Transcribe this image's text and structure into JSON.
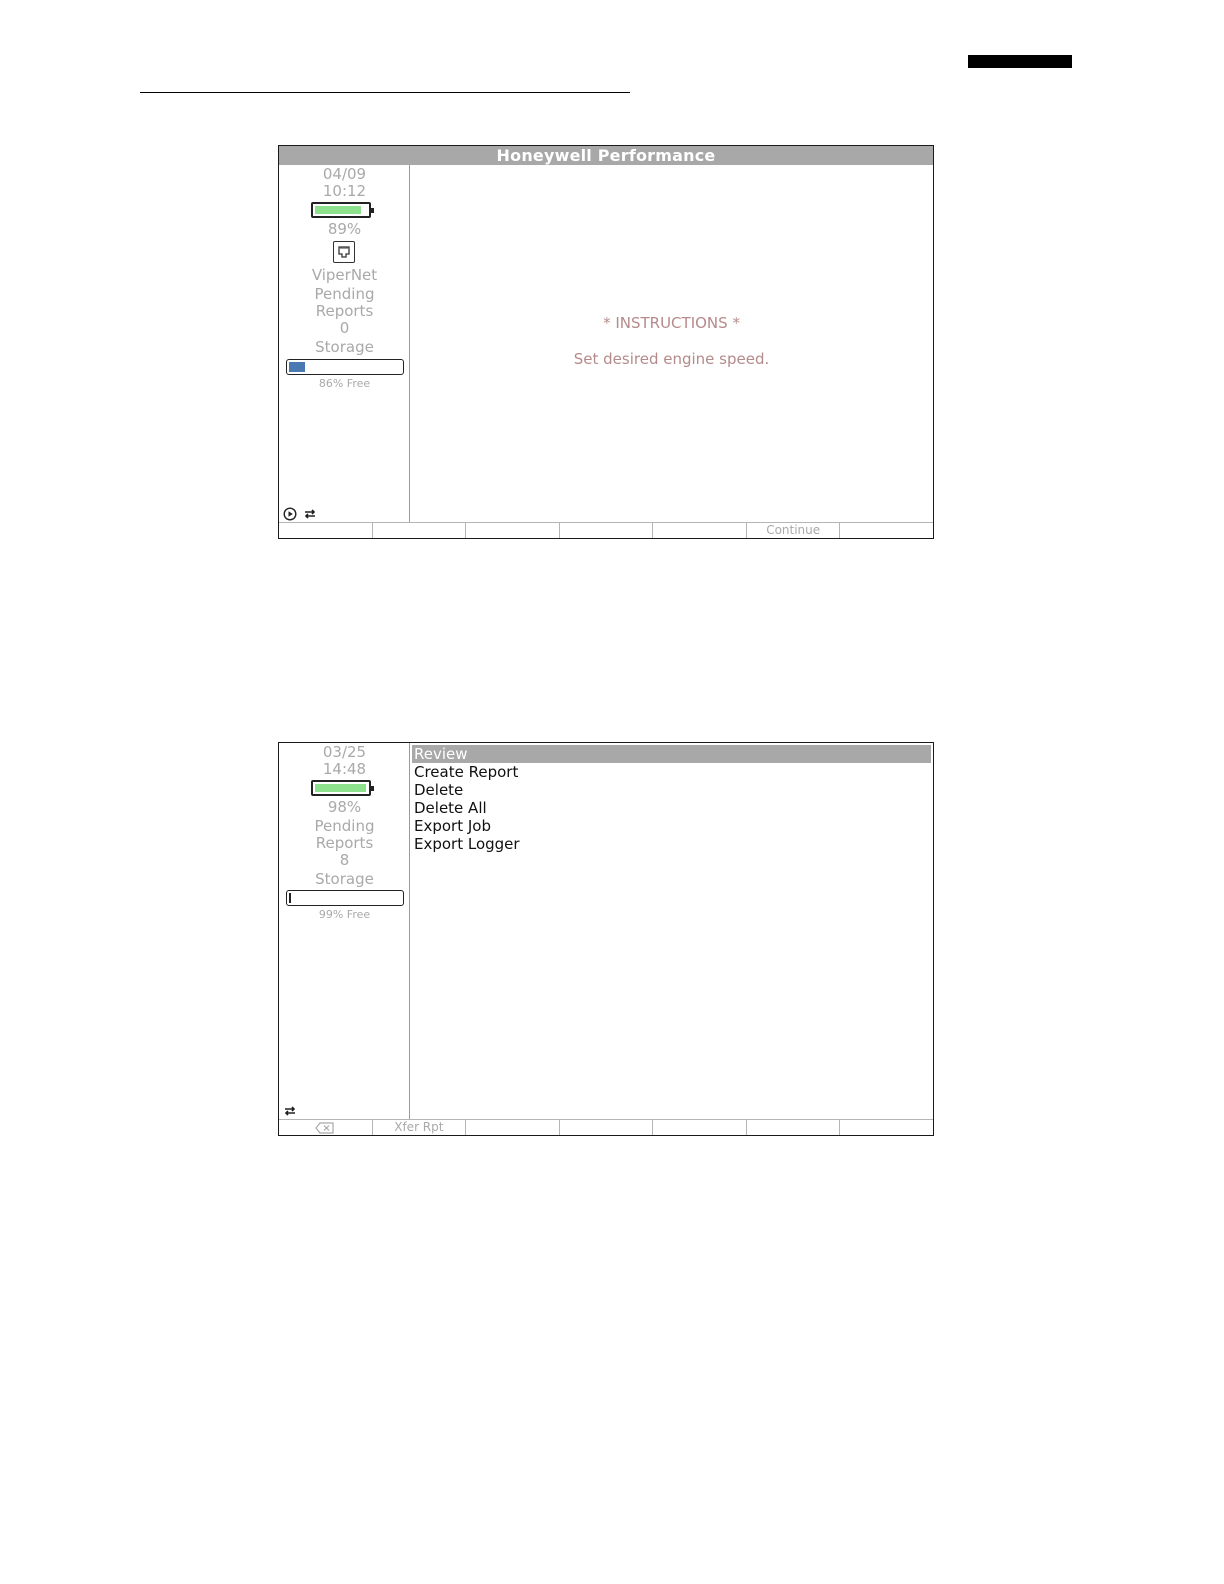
{
  "screen1": {
    "title": "Honeywell Performance",
    "sidebar": {
      "date": "04/09",
      "time": "10:12",
      "battery_level": 0.89,
      "battery_percent": "89%",
      "network_label": "ViperNet",
      "pending_label_1": "Pending",
      "pending_label_2": "Reports",
      "pending_count": "0",
      "storage_label": "Storage",
      "storage_used": 0.14,
      "storage_free": "86% Free",
      "status_icons": [
        "play-circle-icon",
        "connection-icon"
      ]
    },
    "instructions": {
      "title": "* INSTRUCTIONS *",
      "body": "Set desired engine speed."
    },
    "softkeys": [
      "",
      "",
      "",
      "",
      "",
      "Continue",
      ""
    ]
  },
  "screen2": {
    "sidebar": {
      "date": "03/25",
      "time": "14:48",
      "battery_level": 0.98,
      "battery_percent": "98%",
      "pending_label_1": "Pending",
      "pending_label_2": "Reports",
      "pending_count": "8",
      "storage_label": "Storage",
      "storage_used": 0.01,
      "storage_free": "99% Free",
      "status_icons": [
        "connection-icon"
      ]
    },
    "menu": [
      "Review",
      "Create Report",
      "Delete",
      "Delete All",
      "Export Job",
      "Export Logger"
    ],
    "selected_index": 0,
    "softkeys": [
      "",
      "Xfer Rpt",
      "",
      "",
      "",
      "",
      ""
    ],
    "softkey_icons": [
      "backspace-icon"
    ]
  },
  "colors": {
    "title_bar": "#a8a8a8",
    "battery_fill": "#8ee28e",
    "storage_fill": "#4a78b0",
    "instruction_text": "#b58a8a",
    "sidebar_text": "#a9a9a9"
  }
}
